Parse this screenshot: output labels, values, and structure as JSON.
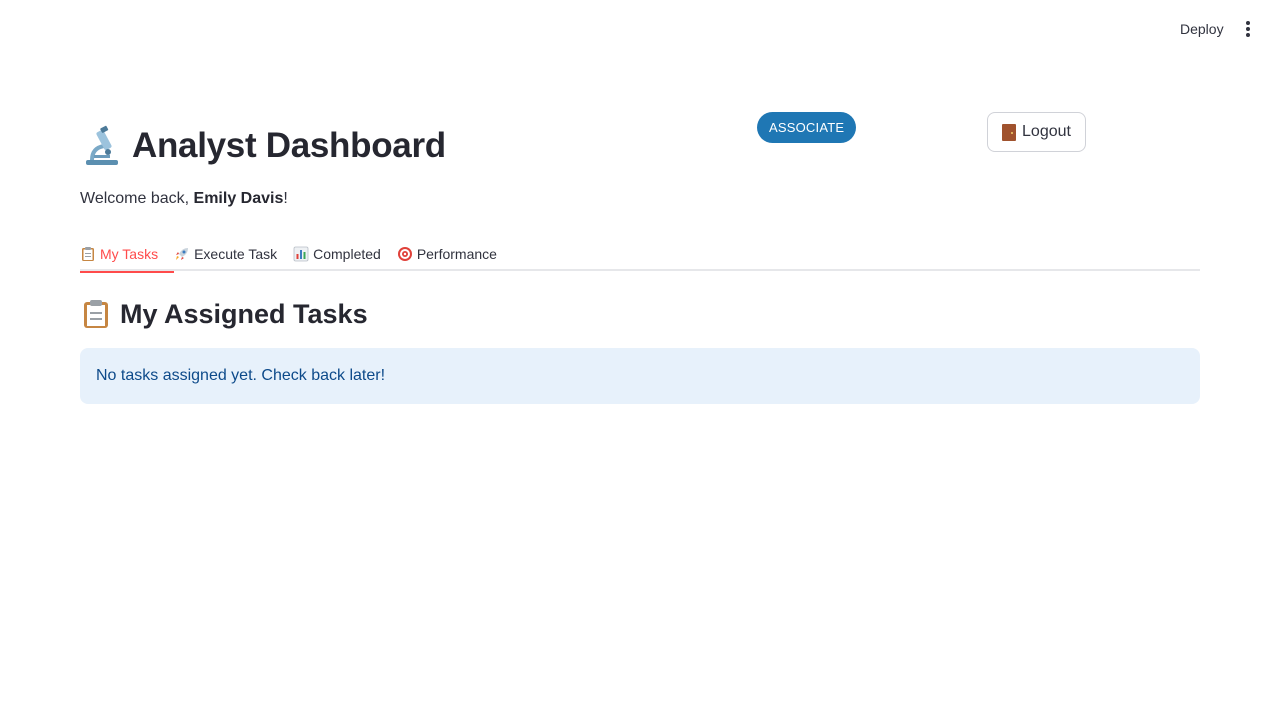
{
  "header": {
    "deploy_label": "Deploy",
    "menu_icon": "kebab-menu-icon"
  },
  "page": {
    "title": "Analyst Dashboard",
    "title_icon": "microscope-icon",
    "role_badge": "ASSOCIATE",
    "logout_label": "Logout",
    "logout_icon": "door-icon",
    "welcome_prefix": "Welcome back, ",
    "user_name": "Emily Davis",
    "welcome_suffix": "!"
  },
  "tabs": [
    {
      "label": "My Tasks",
      "icon": "clipboard-icon",
      "active": true
    },
    {
      "label": "Execute Task",
      "icon": "rocket-icon",
      "active": false
    },
    {
      "label": "Completed",
      "icon": "bar-chart-icon",
      "active": false
    },
    {
      "label": "Performance",
      "icon": "target-icon",
      "active": false
    }
  ],
  "section": {
    "title": "My Assigned Tasks",
    "icon": "clipboard-icon",
    "info_message": "No tasks assigned yet. Check back later!"
  },
  "colors": {
    "accent": "#ff4b4b",
    "badge": "#1f77b4",
    "info_bg": "#e7f1fb",
    "info_text": "#0d4a8a"
  }
}
